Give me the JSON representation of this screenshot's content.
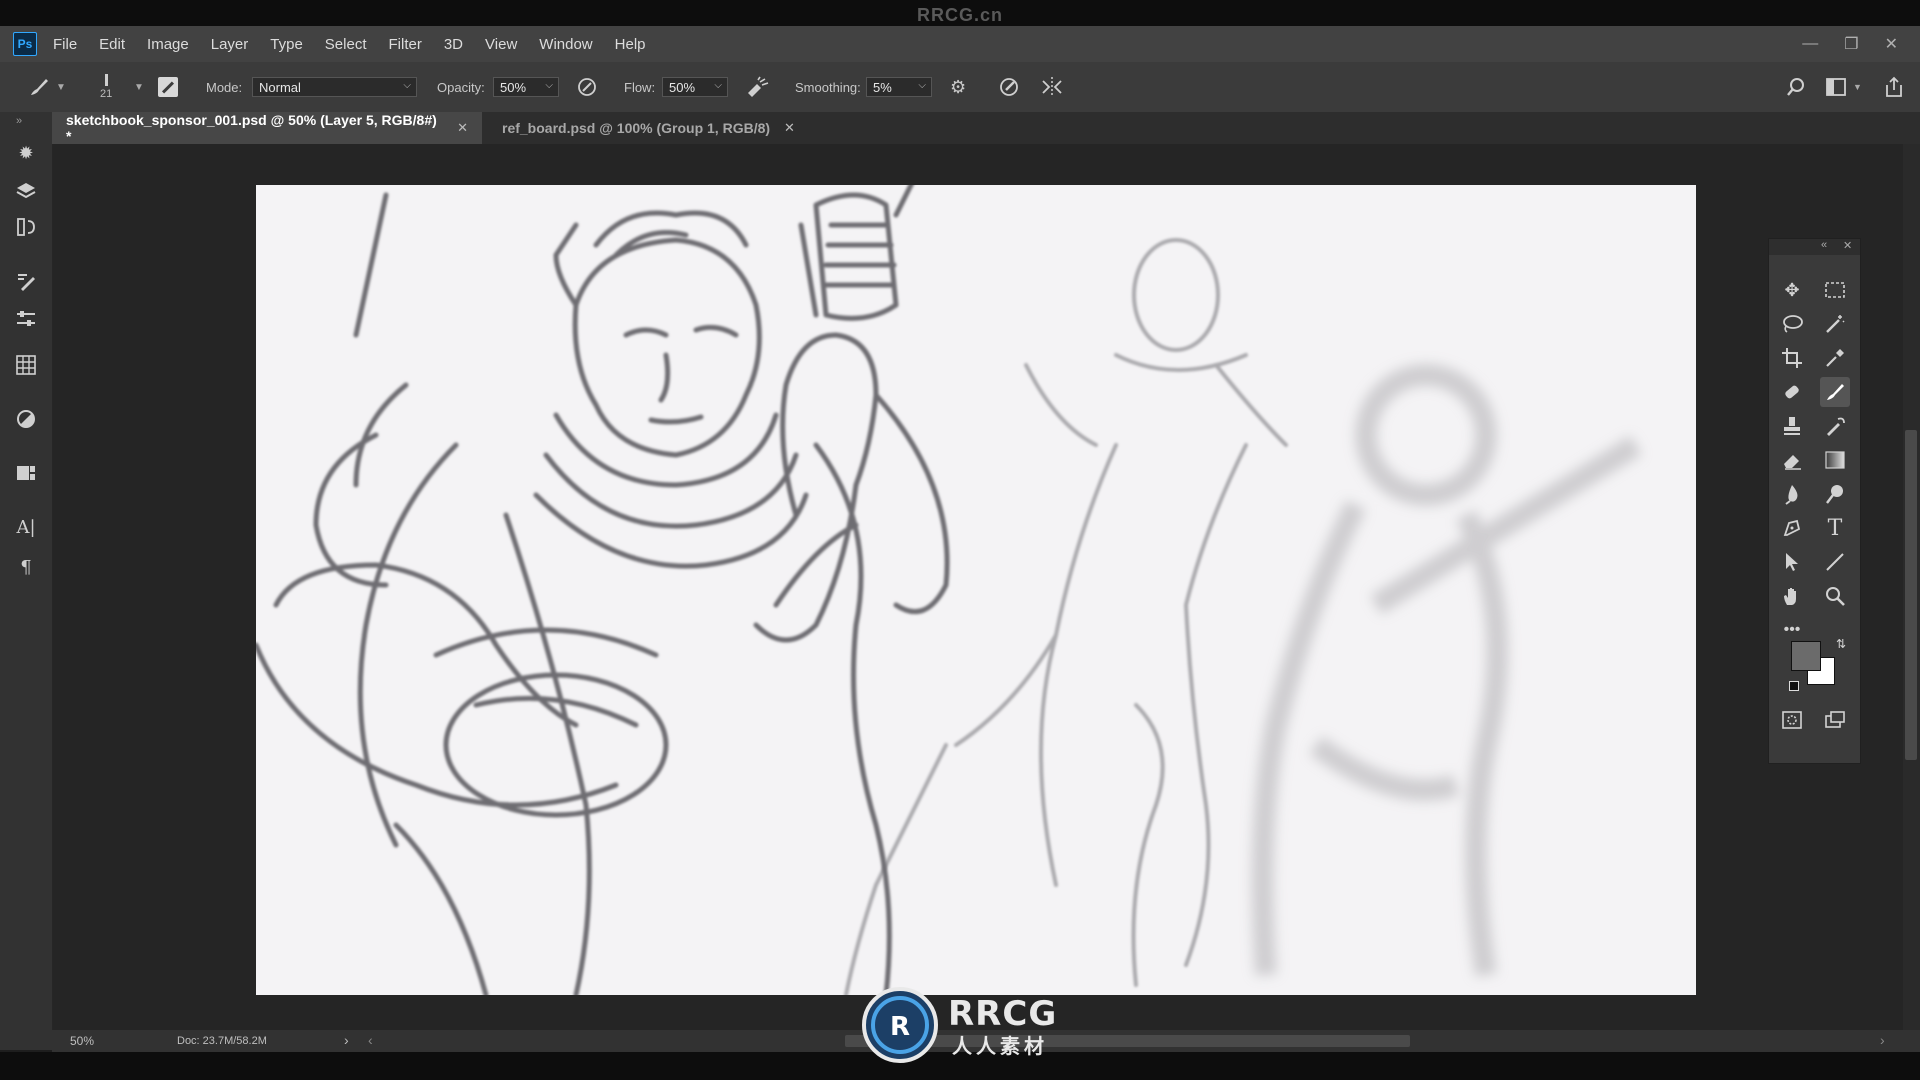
{
  "watermark": {
    "top_text": "RRCG.cn",
    "logo_text": "RRCG",
    "logo_sub": "人人素材"
  },
  "app": {
    "logo": "Ps"
  },
  "menu": [
    "File",
    "Edit",
    "Image",
    "Layer",
    "Type",
    "Select",
    "Filter",
    "3D",
    "View",
    "Window",
    "Help"
  ],
  "options": {
    "brush_size": "21",
    "mode_label": "Mode:",
    "mode_value": "Normal",
    "opacity_label": "Opacity:",
    "opacity_value": "50%",
    "flow_label": "Flow:",
    "flow_value": "50%",
    "smoothing_label": "Smoothing:",
    "smoothing_value": "5%"
  },
  "tabs": [
    {
      "label": "sketchbook_sponsor_001.psd @ 50% (Layer 5, RGB/8#) *",
      "active": true
    },
    {
      "label": "ref_board.psd @ 100% (Group 1, RGB/8)",
      "active": false
    }
  ],
  "status": {
    "zoom": "50%",
    "doc": "Doc: 23.7M/58.2M"
  },
  "colors": {
    "foreground": "#6b6b6b",
    "background": "#ffffff",
    "accent": "#31a8ff"
  }
}
